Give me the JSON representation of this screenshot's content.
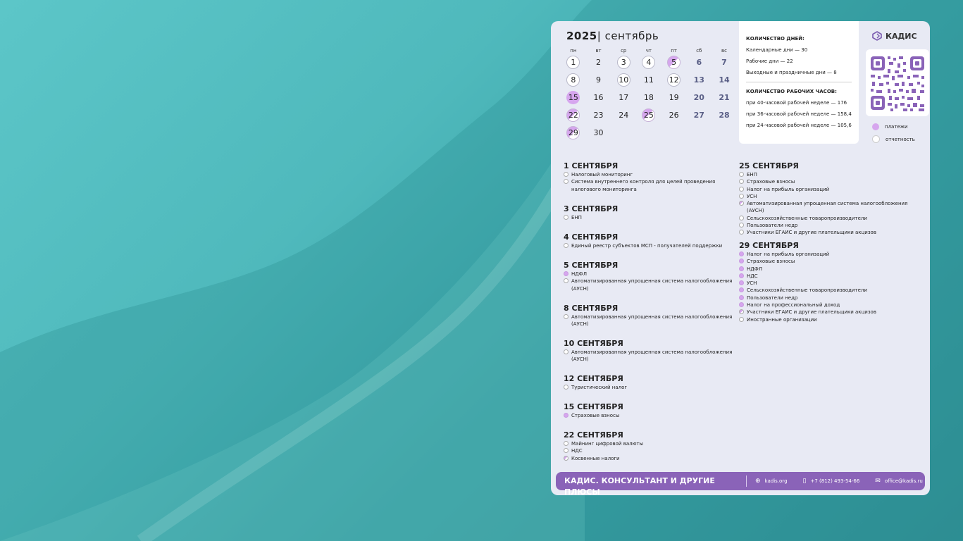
{
  "calendar": {
    "year": "2025",
    "month": "сентябрь",
    "weekdays": [
      "пн",
      "вт",
      "ср",
      "чт",
      "пт",
      "сб",
      "вс"
    ],
    "weeks": [
      [
        {
          "d": "1",
          "t": "outline"
        },
        {
          "d": "2",
          "t": ""
        },
        {
          "d": "3",
          "t": "outline"
        },
        {
          "d": "4",
          "t": "outline"
        },
        {
          "d": "5",
          "t": "half"
        },
        {
          "d": "6",
          "t": "we"
        },
        {
          "d": "7",
          "t": "we"
        }
      ],
      [
        {
          "d": "8",
          "t": "outline"
        },
        {
          "d": "9",
          "t": ""
        },
        {
          "d": "10",
          "t": "outline"
        },
        {
          "d": "11",
          "t": ""
        },
        {
          "d": "12",
          "t": "outline"
        },
        {
          "d": "13",
          "t": "we"
        },
        {
          "d": "14",
          "t": "we"
        }
      ],
      [
        {
          "d": "15",
          "t": "pay"
        },
        {
          "d": "16",
          "t": ""
        },
        {
          "d": "17",
          "t": ""
        },
        {
          "d": "18",
          "t": ""
        },
        {
          "d": "19",
          "t": ""
        },
        {
          "d": "20",
          "t": "we"
        },
        {
          "d": "21",
          "t": "we"
        }
      ],
      [
        {
          "d": "22",
          "t": "half"
        },
        {
          "d": "23",
          "t": ""
        },
        {
          "d": "24",
          "t": ""
        },
        {
          "d": "25",
          "t": "half"
        },
        {
          "d": "26",
          "t": ""
        },
        {
          "d": "27",
          "t": "we"
        },
        {
          "d": "28",
          "t": "we"
        }
      ],
      [
        {
          "d": "29",
          "t": "half"
        },
        {
          "d": "30",
          "t": ""
        },
        {
          "d": "",
          "t": ""
        },
        {
          "d": "",
          "t": ""
        },
        {
          "d": "",
          "t": ""
        },
        {
          "d": "",
          "t": ""
        },
        {
          "d": "",
          "t": ""
        }
      ]
    ]
  },
  "info": {
    "days_heading": "КОЛИЧЕСТВО ДНЕЙ:",
    "calendar_days": "Календарные дни — 30",
    "working_days": "Рабочие дни — 22",
    "holidays": "Выходные и праздничные дни — 8",
    "hours_heading": "КОЛИЧЕСТВО РАБОЧИХ ЧАСОВ:",
    "h40": "при 40-часовой рабочей неделе — 176",
    "h36": "при 36-часовой рабочей неделе — 158,4",
    "h24": "при 24-часовой рабочей неделе — 105,6"
  },
  "brand": {
    "logo": "КАДИС"
  },
  "legend": {
    "payments": "платежи",
    "reports": "отчетность"
  },
  "events_left": [
    {
      "date": "1 СЕНТЯБРЯ",
      "items": [
        {
          "t": "Налоговый мониторинг",
          "k": "rep"
        },
        {
          "t": "Система внутреннего контроля для целей проведения налогового мониторинга",
          "k": "rep"
        }
      ]
    },
    {
      "date": "3 СЕНТЯБРЯ",
      "items": [
        {
          "t": "ЕНП",
          "k": "rep"
        }
      ]
    },
    {
      "date": "4 СЕНТЯБРЯ",
      "items": [
        {
          "t": "Единый реестр субъектов МСП - получателей поддержки",
          "k": "rep"
        }
      ]
    },
    {
      "date": "5 СЕНТЯБРЯ",
      "items": [
        {
          "t": "НДФЛ",
          "k": "pay"
        },
        {
          "t": "Автоматизированная упрощенная система налогообложения (АУСН)",
          "k": "rep"
        }
      ]
    },
    {
      "date": "8 СЕНТЯБРЯ",
      "items": [
        {
          "t": "Автоматизированная упрощенная система налогообложения (АУСН)",
          "k": "rep"
        }
      ]
    },
    {
      "date": "10 СЕНТЯБРЯ",
      "items": [
        {
          "t": "Автоматизированная упрощенная система налогообложения (АУСН)",
          "k": "rep"
        }
      ]
    },
    {
      "date": "12 СЕНТЯБРЯ",
      "items": [
        {
          "t": "Туристический налог",
          "k": "rep"
        }
      ]
    },
    {
      "date": "15 СЕНТЯБРЯ",
      "items": [
        {
          "t": "Страховые взносы",
          "k": "pay"
        }
      ]
    },
    {
      "date": "22 СЕНТЯБРЯ",
      "items": [
        {
          "t": "Майнинг цифровой валюты",
          "k": "rep"
        },
        {
          "t": "НДС",
          "k": "rep"
        },
        {
          "t": "Косвенные налоги",
          "k": "half"
        }
      ]
    }
  ],
  "events_right": [
    {
      "date": "25 СЕНТЯБРЯ",
      "items": [
        {
          "t": "ЕНП",
          "k": "rep"
        },
        {
          "t": "Страховые взносы",
          "k": "rep"
        },
        {
          "t": "Налог на прибыль организаций",
          "k": "rep"
        },
        {
          "t": "УСН",
          "k": "rep"
        },
        {
          "t": "Автоматизированная упрощенная система налогообложения (АУСН)",
          "k": "half"
        },
        {
          "t": "Сельскохозяйственные товаропроизводители",
          "k": "rep"
        },
        {
          "t": "Пользователи недр",
          "k": "rep"
        },
        {
          "t": "Участники ЕГАИС и другие плательщики акцизов",
          "k": "rep"
        }
      ]
    },
    {
      "date": "29 СЕНТЯБРЯ",
      "items": [
        {
          "t": "Налог на прибыль организаций",
          "k": "pay"
        },
        {
          "t": "Страховые взносы",
          "k": "pay"
        },
        {
          "t": "НДФЛ",
          "k": "pay"
        },
        {
          "t": "НДС",
          "k": "pay"
        },
        {
          "t": "УСН",
          "k": "pay"
        },
        {
          "t": "Сельскохозяйственные товаропроизводители",
          "k": "pay"
        },
        {
          "t": "Пользователи недр",
          "k": "pay"
        },
        {
          "t": "Налог на профессиональный доход",
          "k": "pay"
        },
        {
          "t": "Участники ЕГАИС и другие плательщики акцизов",
          "k": "half"
        },
        {
          "t": "Иностранные организации",
          "k": "rep"
        }
      ]
    }
  ],
  "footer": {
    "brand": "КАДИС. КОНСУЛЬТАНТ И ДРУГИЕ ПЛЮСЫ",
    "site": "kadis.org",
    "phone": "+7 (812) 493-54-66",
    "email": "office@kadis.ru"
  }
}
